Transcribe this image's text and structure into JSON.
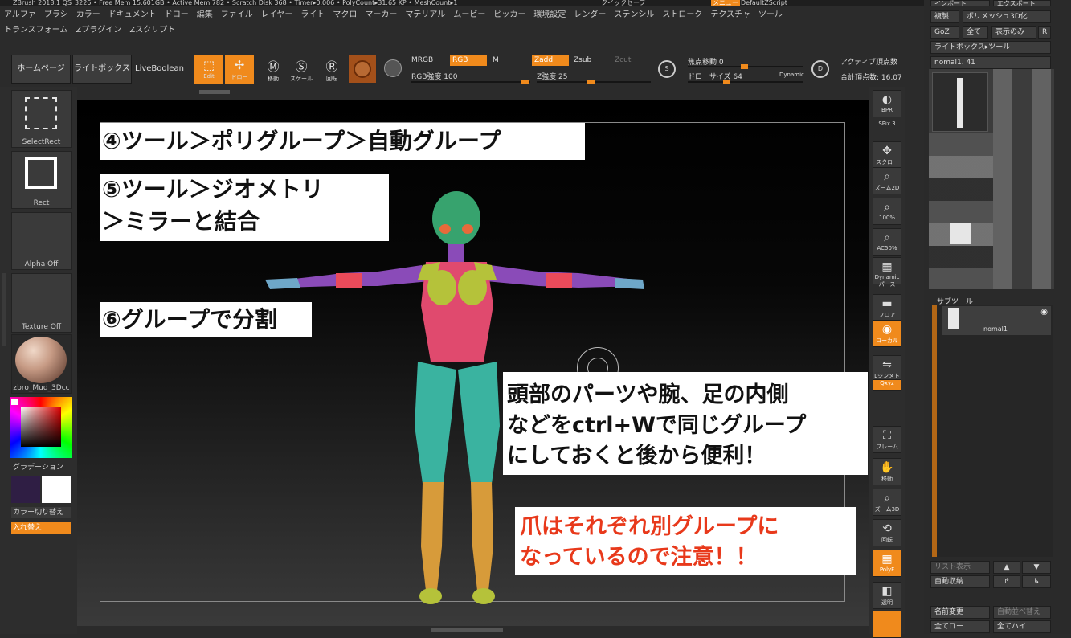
{
  "titlebar": "ZBrush 2018.1 QS_3226  •  Free Mem 15.601GB • Active Mem 782 • Scratch Disk 368 • Timer▸0.006 • PolyCount▸31.65 KP • MeshCount▸1",
  "title_right": {
    "a": "クイックセーブ",
    "b": "メニュー",
    "c": "DefaultZScript"
  },
  "menu1": [
    "アルファ",
    "ブラシ",
    "カラー",
    "ドキュメント",
    "ドロー",
    "編集",
    "ファイル",
    "レイヤー",
    "ライト",
    "マクロ",
    "マーカー",
    "マテリアル",
    "ムービー",
    "ピッカー",
    "環境設定",
    "レンダー",
    "ステンシル",
    "ストローク",
    "テクスチャ",
    "ツール"
  ],
  "menu2": [
    "トランスフォーム",
    "Zプラグイン",
    "Zスクリプト"
  ],
  "toolbar": {
    "home": "ホームページ",
    "lightbox": "ライトボックス",
    "liveboolean": "LiveBoolean",
    "edit": "Edit",
    "draw": "ドロー",
    "move": "移動",
    "scale": "スケール",
    "rotate": "回転",
    "mrgb": "MRGB",
    "rgb": "RGB",
    "m": "M",
    "rgb_strength": "RGB強度 100",
    "zadd": "Zadd",
    "zsub": "Zsub",
    "zcut": "Zcut",
    "z_strength": "Z強度 25",
    "focal_shift": "焦点移動 0",
    "draw_size": "ドローサイズ 64",
    "dynamic": "Dynamic",
    "active_points": "アクティブ頂点数",
    "total_points": "合計頂点数: 16,07"
  },
  "left": {
    "select_rect": "SelectRect",
    "rect": "Rect",
    "alpha": "Alpha Off",
    "texture": "Texture Off",
    "material": "zbro_Mud_3Dcc",
    "gradient": "グラデーション",
    "color_switch": "カラー切り替え",
    "swap": "入れ替え"
  },
  "right_icons": [
    "BPR",
    "SPix 3",
    "スクロール",
    "ズーム2D",
    "100%",
    "AC50%",
    "Dynamic パース",
    "フロア",
    "ローカル",
    "Lシンメトリ",
    "Qxyz",
    "フレーム",
    "移動",
    "ズーム3D",
    "回転",
    "PolyF",
    "透明",
    ""
  ],
  "rightpanel": {
    "import": "インポート",
    "export": "エクスポート",
    "clone": "複製",
    "polymesh": "ポリメッシュ3D化",
    "goz": "GoZ",
    "all": "全て",
    "visible": "表示のみ",
    "r": "R",
    "lightbox_tool": "ライトボックス▸ツール",
    "tool_name": "nomal1. 41",
    "subtool": "サブツール",
    "subtool_item": "nomal1",
    "list_all": "リスト表示",
    "auto_collapse": "自動収納",
    "rename": "名前変更",
    "auto_reorder": "自動並べ替え",
    "all_low": "全てロー",
    "all_high": "全てハイ"
  },
  "callouts": {
    "c4": "④ツール＞ポリグループ＞自動グループ",
    "c5a": "⑤ツール＞ジオメトリ",
    "c5b": "＞ミラーと結合",
    "c6": "⑥グループで分割",
    "note1": "頭部のパーツや腕、足の内側",
    "note2": "などをctrl+Wで同じグループ",
    "note3": "にしておくと後から便利！",
    "warn1": "爪はそれぞれ別グループに",
    "warn2": "なっているので注意！！"
  },
  "colors": {
    "accent": "#f08a1c",
    "warn_text": "#e8391b"
  }
}
